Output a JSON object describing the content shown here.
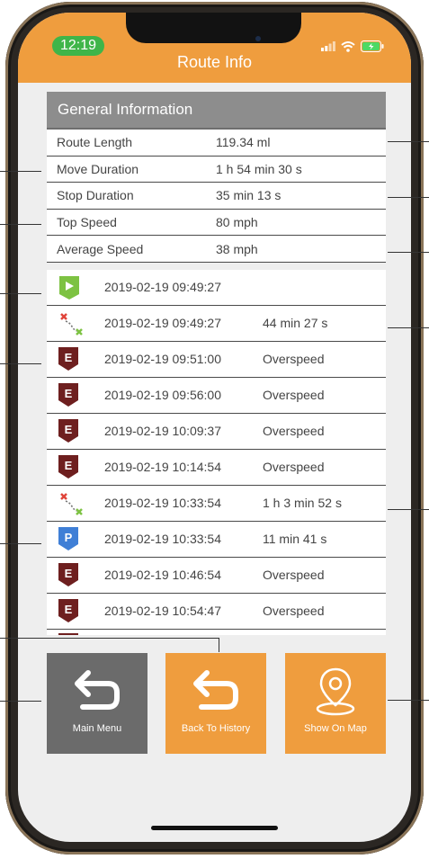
{
  "status_bar": {
    "time": "12:19"
  },
  "header": {
    "title": "Route Info"
  },
  "general": {
    "title": "General Information",
    "rows": [
      {
        "label": "Route Length",
        "value": "119.34 ml"
      },
      {
        "label": "Move Duration",
        "value": "1 h 54 min 30 s"
      },
      {
        "label": "Stop Duration",
        "value": "35 min 13 s"
      },
      {
        "label": "Top Speed",
        "value": "80 mph"
      },
      {
        "label": "Average Speed",
        "value": "38 mph"
      }
    ]
  },
  "events": [
    {
      "icon": "start-flag-icon",
      "datetime": "2019-02-19 09:49:27",
      "extra": ""
    },
    {
      "icon": "move-route-icon",
      "datetime": "2019-02-19 09:49:27",
      "extra": "44 min 27 s"
    },
    {
      "icon": "overspeed-event-icon",
      "datetime": "2019-02-19 09:51:00",
      "extra": "Overspeed"
    },
    {
      "icon": "overspeed-event-icon",
      "datetime": "2019-02-19 09:56:00",
      "extra": "Overspeed"
    },
    {
      "icon": "overspeed-event-icon",
      "datetime": "2019-02-19 10:09:37",
      "extra": "Overspeed"
    },
    {
      "icon": "overspeed-event-icon",
      "datetime": "2019-02-19 10:14:54",
      "extra": "Overspeed"
    },
    {
      "icon": "move-route-icon",
      "datetime": "2019-02-19 10:33:54",
      "extra": "1 h 3 min 52 s"
    },
    {
      "icon": "parking-icon",
      "datetime": "2019-02-19 10:33:54",
      "extra": "11 min 41 s"
    },
    {
      "icon": "overspeed-event-icon",
      "datetime": "2019-02-19 10:46:54",
      "extra": "Overspeed"
    },
    {
      "icon": "overspeed-event-icon",
      "datetime": "2019-02-19 10:54:47",
      "extra": "Overspeed"
    }
  ],
  "event_icon_letters": {
    "overspeed": "E",
    "parking": "P"
  },
  "buttons": {
    "main_menu": "Main Menu",
    "back_to_history": "Back To History",
    "show_on_map": "Show On Map"
  },
  "colors": {
    "accent": "#ef9d3e",
    "status_green": "#3fb549",
    "section_gray": "#8d8d8d",
    "button_gray": "#6b6b6b",
    "event_maroon": "#6e1f1f",
    "parking_blue": "#3f7fd6",
    "start_green": "#7dc242"
  }
}
